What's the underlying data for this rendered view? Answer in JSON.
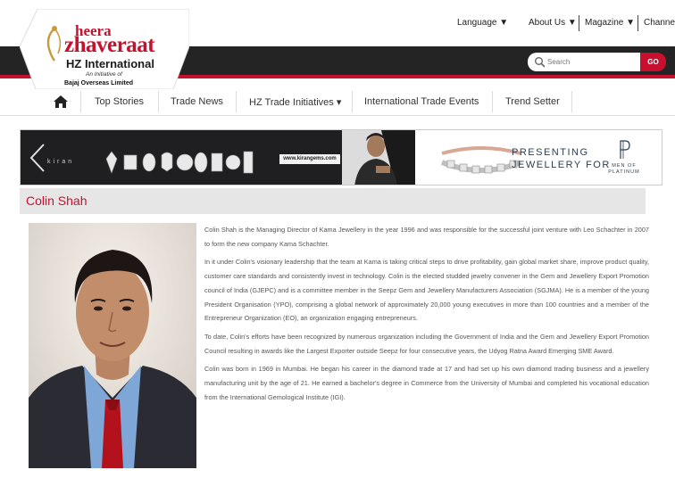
{
  "topnav": {
    "language": "Language ▼",
    "about_us": "About Us ▼",
    "magazine": "Magazine ▼",
    "channel": "Channel"
  },
  "logo": {
    "heera": "heera",
    "zhaveraat": "zhaveraat",
    "hz_international": "HZ International",
    "initiative": "An Initiative of",
    "bajaj": "Bajaj Overseas Limited"
  },
  "search": {
    "placeholder": "Search",
    "go_label": "GO"
  },
  "mainnav": {
    "items": [
      {
        "label": "Top Stories"
      },
      {
        "label": "Trade News"
      },
      {
        "label": "HZ Trade Initiatives ▾"
      },
      {
        "label": "International Trade Events"
      },
      {
        "label": "Trend Setter"
      }
    ]
  },
  "banner": {
    "brand": "kiran",
    "url": "www.kirangems.com",
    "presenting": "PRESENTING",
    "jewellery_for": "JEWELLERY FOR",
    "men_of": "MEN OF",
    "platinum": "PLATINUM"
  },
  "page": {
    "title": "Colin Shah"
  },
  "bio": {
    "paragraphs": [
      "Colin Shah is the Managing Director of Kama Jewellery in the year 1996 and was responsible for the successful joint venture with Leo Schachter in 2007 to form the new company Kama Schachter.",
      "In it under Colin's visionary leadership that the team at Kama is taking critical steps to drive profitability, gain global market share, improve product quality, customer care standards and consistently invest in technology. Colin is the elected studded jewelry convener in the Gem and Jewellery Export Promotion council of India (GJEPC) and is a committee member in the Seepz Gem and Jewellery Manufacturers Association (SGJMA). He is a member of the young President Organisation (YPO), comprising a global network of approximately 20,000 young executives in more than 100 countries and a member of the Entrepreneur Organization (EO), an organization engaging entrepreneurs.",
      "To date, Colin's efforts have been recognized by numerous organization including the Government of India and the Gem and Jewellery Export Promotion Council resulting in awards like the Largest Exporter outside Seepz for four consecutive years, the Udyog Ratna Award Emerging SME Award.",
      "Colin was born in 1969 in Mumbai. He began his career in the diamond trade at 17 and had set up his own diamond trading business and a jewellery manufacturing unit by the age of 21. He earned a bachelor's degree in Commerce from the University of Mumbai and completed his vocational education from the International Gemological Institute (IGI)."
    ]
  },
  "colors": {
    "brand_red": "#c8102e",
    "dark_band": "#242424",
    "title_bg": "#e6e6e6"
  },
  "icons": [
    "home-icon",
    "search-icon",
    "kiran-logo-icon",
    "platinum-p-icon"
  ]
}
